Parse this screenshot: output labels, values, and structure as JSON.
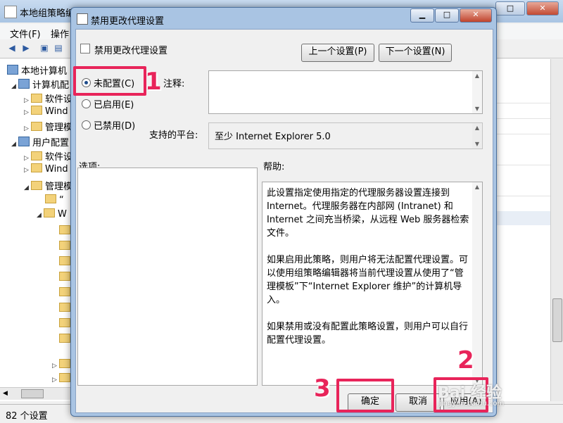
{
  "background_window": {
    "title": "本地组策略编",
    "menu": [
      "文件(F)",
      "操作"
    ],
    "tree": [
      {
        "label": "本地计算机",
        "indent": 0
      },
      {
        "label": "计算机配",
        "indent": 1
      },
      {
        "label": "软件设",
        "indent": 2
      },
      {
        "label": "Wind",
        "indent": 2
      },
      {
        "label": "管理模",
        "indent": 2
      },
      {
        "label": "用户配置",
        "indent": 1
      },
      {
        "label": "软件设",
        "indent": 2
      },
      {
        "label": "Wind",
        "indent": 2
      },
      {
        "label": "管理模",
        "indent": 2
      },
      {
        "label": "“",
        "indent": 3
      },
      {
        "label": "W",
        "indent": 3
      }
    ],
    "status": "82 个设置"
  },
  "dialog": {
    "title": "禁用更改代理设置",
    "policy_name": "禁用更改代理设置",
    "prev_label": "上一个设置(P)",
    "next_label": "下一个设置(N)",
    "radios": [
      {
        "label": "未配置(C)",
        "checked": true
      },
      {
        "label": "已启用(E)",
        "checked": false
      },
      {
        "label": "已禁用(D)",
        "checked": false
      }
    ],
    "comment_label": "注释:",
    "comment_value": "",
    "platform_label": "支持的平台:",
    "platform_value": "至少 Internet Explorer 5.0",
    "options_label": "选项:",
    "help_label": "帮助:",
    "help_text": "此设置指定使用指定的代理服务器设置连接到 Internet。代理服务器在内部网 (Intranet) 和 Internet 之间充当桥梁，从远程 Web 服务器检索文件。\n\n如果启用此策略，则用户将无法配置代理设置。可以使用组策略编辑器将当前代理设置从使用了“管理模板”下“Internet Explorer 维护”的计算机导入。\n\n如果禁用或没有配置此策略设置，则用户可以自行配置代理设置。",
    "ok_label": "确定",
    "cancel_label": "取消",
    "apply_label": "应用(A)"
  },
  "annotations": {
    "step1": "1",
    "step2": "2",
    "step3": "3",
    "highlight_color": "#e8245a"
  },
  "watermark": {
    "brand": "Bai 经验",
    "url": "jingyan.baidu.com"
  }
}
